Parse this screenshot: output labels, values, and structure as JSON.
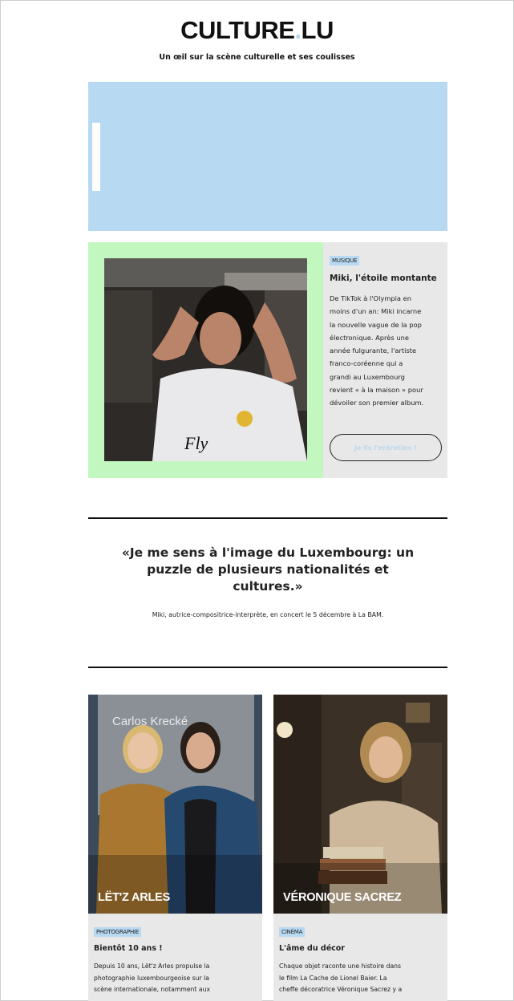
{
  "header": {
    "logo_left": "CULTURE",
    "logo_dot": ".",
    "logo_right": "LU",
    "tagline": "Un œil sur la scène culturelle et ses coulisses"
  },
  "colors": {
    "accent_blue": "#b8d9f2",
    "feature_green": "#c3f7c0",
    "card_gray": "#e8e8e8"
  },
  "feature": {
    "tag": "MUSIQUE",
    "title": "Miki, l'étoile montante",
    "body_lines": [
      "De TikTok à l'Olympia en",
      "moins d'un an: Miki incarne",
      "la nouvelle vague de la pop",
      "électronique. Après une",
      "année fulgurante, l'artiste",
      "franco-coréenne qui a",
      "grandi au Luxembourg",
      "revient « à la maison » pour",
      "dévoiler son premier album."
    ],
    "cta": "Je lis l'entretien !",
    "photo_text": "Fly"
  },
  "quote": {
    "lines": [
      "«Je me sens à l'image du Luxembourg: un",
      "puzzle de plusieurs nationalités et",
      "cultures.»"
    ],
    "attribution": "Miki, autrice-compositrice-interprète, en concert le 5 décembre à La BAM."
  },
  "cards": [
    {
      "caption": "LËT'Z ARLES",
      "poster_text": "Carlos Krecké",
      "tag": "PHOTOGRAPHIE",
      "title": "Bientôt 10 ans !",
      "body_lines": [
        "Depuis 10 ans, Lët'z Arles propulse la",
        "photographie luxembourgeoise sur la",
        "scène internationale, notamment aux"
      ]
    },
    {
      "caption": "VÉRONIQUE SACREZ",
      "tag": "CINÉMA",
      "title": "L'âme du décor",
      "body_lines": [
        "Chaque objet raconte une histoire dans",
        "le film La Cache de Lionel Baier. La",
        "cheffe décoratrice Véronique Sacrez y a"
      ]
    }
  ]
}
